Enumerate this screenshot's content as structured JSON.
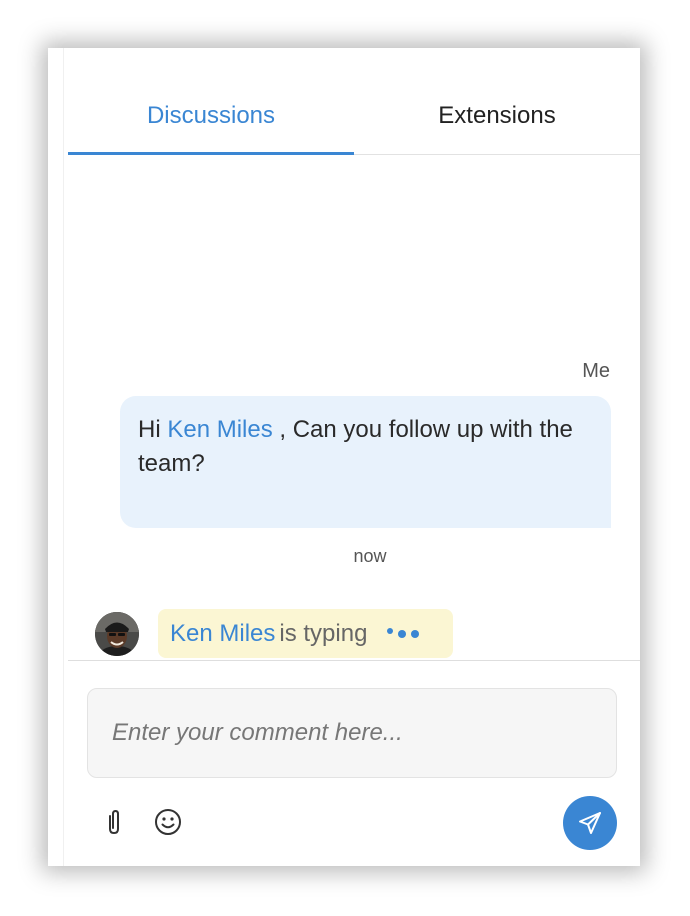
{
  "tabs": [
    {
      "label": "Discussions",
      "active": true
    },
    {
      "label": "Extensions",
      "active": false
    }
  ],
  "message": {
    "sender": "Me",
    "text_before": "Hi ",
    "mention": "Ken Miles",
    "text_after": " , Can you follow up with the team?",
    "time": "now"
  },
  "typing": {
    "name": "Ken Miles",
    "status": "is typing"
  },
  "composer": {
    "placeholder": "Enter your comment here...",
    "attach_icon": "paperclip-icon",
    "emoji_icon": "smiley-icon",
    "send_icon": "send-icon"
  },
  "colors": {
    "accent": "#3a86d3",
    "bubble": "#e8f2fc",
    "typing_bg": "#fbf6d3"
  }
}
